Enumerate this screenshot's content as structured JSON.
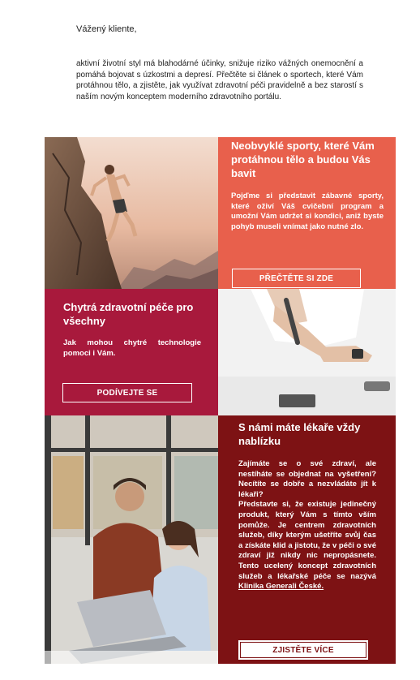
{
  "greeting": "Vážený kliente,",
  "intro": "aktivní životní styl má blahodárné účinky, snižuje riziko vážných onemocnění a pomáhá bojovat s úzkostmi a depresí. Přečtěte si článek o sportech, které Vám protáhnou tělo, a zjistěte, jak využívat zdravotní péči pravidelně a bez starostí s naším novým konceptem moderního zdravotního portálu.",
  "sports": {
    "title": "Neobvyklé sporty, které Vám protáhnou tělo a budou Vás bavit",
    "body": "Pojďme si představit zábavné sporty, které oživí Váš cvičební program a umožní Vám udržet si kondici, aniž byste pohyb museli vnímat jako nutné zlo.",
    "button": "PŘEČTĚTE SI ZDE"
  },
  "smart": {
    "title": "Chytrá zdravotní péče pro všechny",
    "body": "Jak mohou chytré technologie pomoci i Vám.",
    "button": "PODÍVEJTE SE"
  },
  "doctor": {
    "title": "S námi máte lékaře vždy nablízku",
    "body1": "Zajímáte se o své zdraví, ale nestíháte se objednat na vyšetření? Necítíte se dobře a nezvládáte jít k lékaři?",
    "body2": "Představte si, že existuje jedinečný produkt, který Vám s tímto vším pomůže. Je centrem zdravotních služeb, díky kterým ušetříte svůj čas a získáte klid a jistotu, že v péči o své zdraví již nikdy nic nepropásnete. Tento ucelený koncept zdravotních služeb a lékařské péče se nazývá",
    "link": "Klinika Generali České.",
    "button": "ZJISTĚTE VÍCE"
  },
  "colors": {
    "coral": "#e8604c",
    "crimson": "#a8193c",
    "maroon": "#7d1214"
  },
  "images": [
    "rock-climber-photo",
    "glucose-test-photo",
    "couple-laptop-photo"
  ]
}
